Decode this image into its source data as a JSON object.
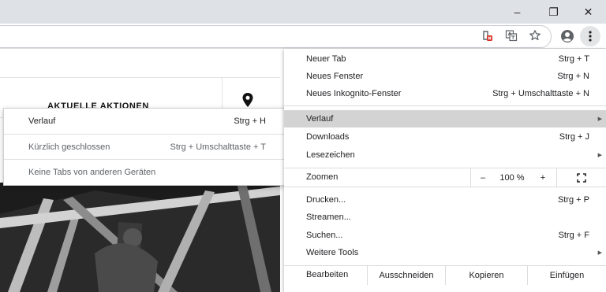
{
  "window": {
    "minimize_glyph": "–",
    "maximize_glyph": "❐",
    "close_glyph": "✕"
  },
  "toolbar": {
    "icons": [
      "site-blocked-icon",
      "translate-icon",
      "bookmark-star-icon",
      "profile-icon",
      "more-menu-icon"
    ]
  },
  "page": {
    "nav_heading": "AKTUELLE AKTIONEN"
  },
  "history_submenu": {
    "items": [
      {
        "label": "Verlauf",
        "shortcut": "Strg + H"
      },
      {
        "label": "Kürzlich geschlossen",
        "shortcut": "Strg + Umschalttaste + T"
      },
      {
        "label": "Keine Tabs von anderen Geräten",
        "shortcut": ""
      }
    ]
  },
  "menu": {
    "new_tab": {
      "label": "Neuer Tab",
      "shortcut": "Strg + T"
    },
    "new_window": {
      "label": "Neues Fenster",
      "shortcut": "Strg + N"
    },
    "incognito": {
      "label": "Neues Inkognito-Fenster",
      "shortcut": "Strg + Umschalttaste + N"
    },
    "history": {
      "label": "Verlauf"
    },
    "downloads": {
      "label": "Downloads",
      "shortcut": "Strg + J"
    },
    "bookmarks": {
      "label": "Lesezeichen"
    },
    "zoom": {
      "label": "Zoomen",
      "minus": "–",
      "value": "100 %",
      "plus": "+",
      "fullscreen_icon": "fullscreen-icon"
    },
    "print": {
      "label": "Drucken...",
      "shortcut": "Strg + P"
    },
    "cast": {
      "label": "Streamen..."
    },
    "find": {
      "label": "Suchen...",
      "shortcut": "Strg + F"
    },
    "more_tools": {
      "label": "Weitere Tools"
    },
    "edit": {
      "label": "Bearbeiten",
      "cut": "Ausschneiden",
      "copy": "Kopieren",
      "paste": "Einfügen"
    }
  },
  "colors": {
    "titlebar": "#dee1e6",
    "menu_highlight": "#d3d3d3",
    "blocked_badge": "#d93025"
  }
}
